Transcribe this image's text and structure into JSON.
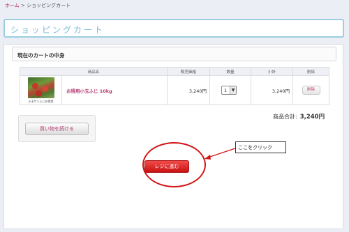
{
  "breadcrumb": {
    "home": "ホーム",
    "separator": " > ",
    "current": "ショッピングカート"
  },
  "page_title": "ショッピングカート",
  "section_header": "現在のカートの中身",
  "table": {
    "headers": [
      "商品名",
      "販売価格",
      "数量",
      "小計",
      "削除"
    ],
    "rows": [
      {
        "thumbnail_caption": "小玉サンふじお得用",
        "name": "お得用小玉ふじ 10kg",
        "price": "3,240円",
        "quantity": "1",
        "subtotal": "3,240円",
        "delete_label": "削除"
      }
    ]
  },
  "total": {
    "label": "商品合計:",
    "value": "3,240円"
  },
  "buttons": {
    "continue": "買い物を続ける",
    "checkout": "レジに進む"
  },
  "annotation": {
    "callout": "ここをクリック",
    "color": "#d31414"
  },
  "colors": {
    "accent": "#b23a6e",
    "title": "#7bbcd6",
    "checkout": "#e02828"
  }
}
